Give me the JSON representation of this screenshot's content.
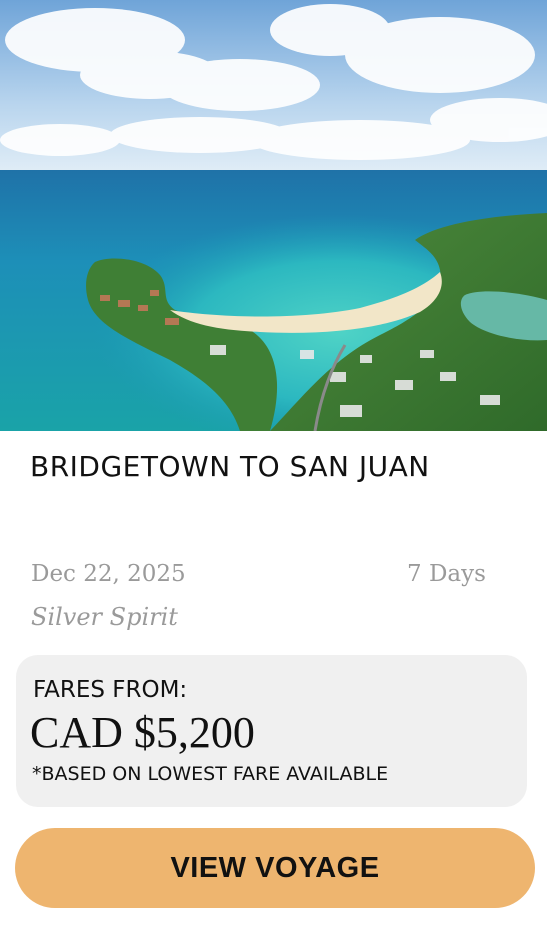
{
  "voyage": {
    "title": "BRIDGETOWN TO SAN JUAN",
    "date": "Dec 22, 2025",
    "duration": "7 Days",
    "ship": "Silver Spirit"
  },
  "fare": {
    "label": "FARES FROM:",
    "price": "CAD $5,200",
    "note": "*BASED ON LOWEST FARE AVAILABLE"
  },
  "cta": {
    "label": "VIEW VOYAGE"
  },
  "colors": {
    "cta_background": "#eeb56f",
    "fare_box_background": "#f0f0f0",
    "muted_text": "#9a9a9a"
  }
}
